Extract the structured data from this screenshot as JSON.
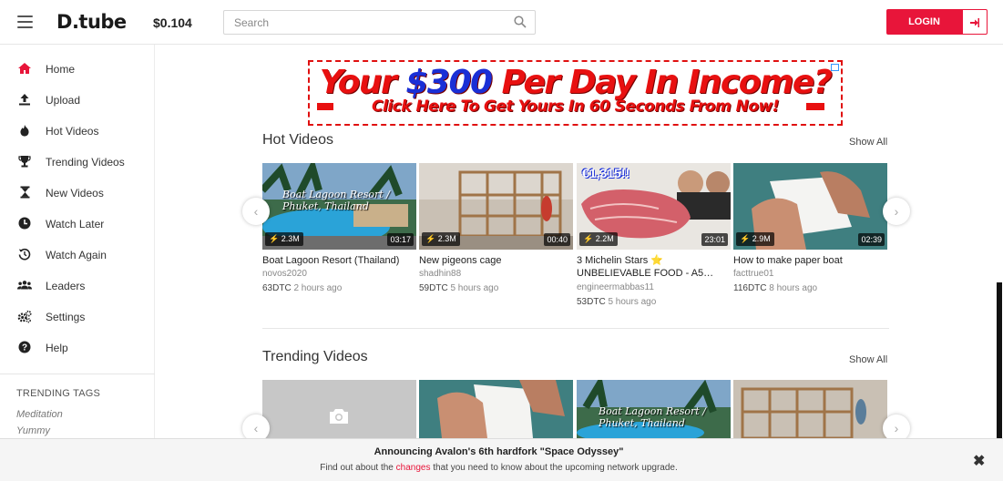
{
  "header": {
    "logo_prefix": "D",
    "logo_suffix": ".tube",
    "price": "$0.104",
    "search_placeholder": "Search",
    "login_label": "LOGIN"
  },
  "sidebar": {
    "items": [
      {
        "label": "Home",
        "icon": "home-icon",
        "active": true
      },
      {
        "label": "Upload",
        "icon": "upload-icon"
      },
      {
        "label": "Hot Videos",
        "icon": "fire-icon"
      },
      {
        "label": "Trending Videos",
        "icon": "trophy-icon"
      },
      {
        "label": "New Videos",
        "icon": "hourglass-icon"
      },
      {
        "label": "Watch Later",
        "icon": "clock-icon"
      },
      {
        "label": "Watch Again",
        "icon": "history-icon"
      },
      {
        "label": "Leaders",
        "icon": "users-icon"
      },
      {
        "label": "Settings",
        "icon": "gears-icon"
      },
      {
        "label": "Help",
        "icon": "help-icon"
      }
    ],
    "trending_tags_title": "TRENDING TAGS",
    "tags": [
      "Meditation",
      "Yummy"
    ]
  },
  "banner": {
    "line1": "Your $300 Per Day In Income?",
    "line2": "Click Here To Get Yours In 60 Seconds From Now!"
  },
  "hot": {
    "title": "Hot Videos",
    "show_all": "Show All",
    "videos": [
      {
        "title": "Boat Lagoon Resort (Thailand)",
        "author": "novos2020",
        "dtc": "63DTC",
        "time": "2 hours ago",
        "views": "2.3M",
        "duration": "03:17",
        "overlay": "Boat Lagoon Resort / Phuket, Thailand"
      },
      {
        "title": "New pigeons cage",
        "author": "shadhin88",
        "dtc": "59DTC",
        "time": "5 hours ago",
        "views": "2.3M",
        "duration": "00:40"
      },
      {
        "title": "3 Michelin Stars ⭐ UNBELIEVABLE FOOD - A5…",
        "author": "engineermabbas11",
        "dtc": "53DTC",
        "time": "5 hours ago",
        "views": "2.2M",
        "duration": "23:01",
        "overlay": "€1,315!!"
      },
      {
        "title": "How to make paper boat",
        "author": "facttrue01",
        "dtc": "116DTC",
        "time": "8 hours ago",
        "views": "2.9M",
        "duration": "02:39"
      }
    ]
  },
  "trending": {
    "title": "Trending Videos",
    "show_all": "Show All",
    "overlay": "Boat Lagoon Resort / Phuket, Thailand"
  },
  "notice": {
    "title": "Announcing Avalon's 6th hardfork \"Space Odyssey\"",
    "text_before": "Find out about the ",
    "link": "changes",
    "text_after": " that you need to know about the upcoming network upgrade.",
    "close": "✖"
  },
  "colors": {
    "accent": "#e8153a",
    "banner_red": "#e81010",
    "banner_blue": "#1a2fd6"
  }
}
